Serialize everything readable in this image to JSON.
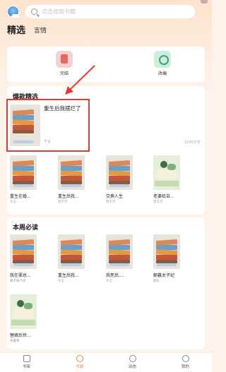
{
  "header": {
    "search_placeholder": "点击搜索书籍"
  },
  "tabs": [
    {
      "label": "精选",
      "active": true
    },
    {
      "label": "言情",
      "active": false
    }
  ],
  "categories": [
    {
      "label": "完结",
      "icon": "book-finished-icon"
    },
    {
      "label": "改编",
      "icon": "adaptation-icon"
    }
  ],
  "hot": {
    "title": "爆款精选",
    "featured": {
      "title": "重生后我摆烂了",
      "meta": "千言",
      "count": "2245万字"
    },
    "books": [
      {
        "title": "重生在婚...",
        "meta": "千言"
      },
      {
        "title": "重生后我...",
        "meta": "百千万"
      },
      {
        "title": "交换人生",
        "meta": "百千万"
      },
      {
        "title": "老婆给自...",
        "meta": "百千万"
      }
    ]
  },
  "weekly": {
    "title": "本周必读",
    "books": [
      {
        "title": "我在罪总...",
        "meta": "橘子味汽水"
      },
      {
        "title": "重生后我...",
        "meta": "千言"
      },
      {
        "title": "我死后,...",
        "meta": "千言"
      },
      {
        "title": "朝暮太子妃",
        "meta": "颜扎"
      },
      {
        "title": "替嫁后世...",
        "meta": "宋葡萄"
      }
    ]
  },
  "tabbar": [
    {
      "label": "书架",
      "active": false
    },
    {
      "label": "书城",
      "active": true
    },
    {
      "label": "动态",
      "active": false
    },
    {
      "label": "我的",
      "active": false
    }
  ],
  "colors": {
    "accent": "#f08a4b",
    "highlight_frame": "#e53935"
  }
}
